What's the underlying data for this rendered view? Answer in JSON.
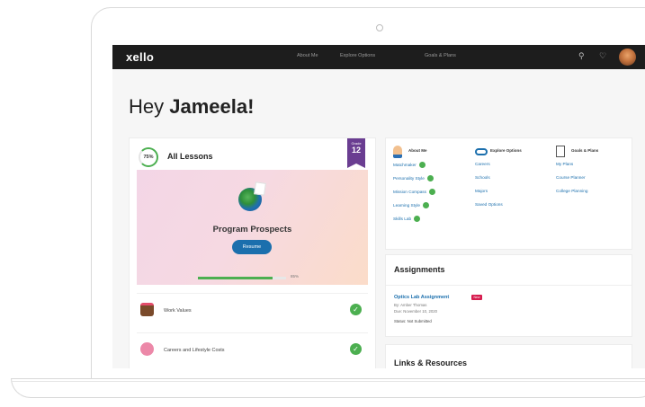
{
  "app": {
    "logo": "xello",
    "nav": [
      "About Me",
      "Explore Options",
      "Goals & Plans"
    ],
    "icons": [
      "search-icon",
      "heart-icon",
      "avatar"
    ]
  },
  "greeting": {
    "prefix": "Hey ",
    "name": "Jameela!"
  },
  "lessons": {
    "progress": "75%",
    "title": "All Lessons",
    "grade_label": "Grade",
    "grade": "12",
    "current": {
      "title": "Program Prospects",
      "button": "Resume",
      "progress_text": "85%",
      "progress_fraction": 0.85
    },
    "items": [
      {
        "label": "Work Values",
        "icon": "briefcase-icon",
        "completed": true
      },
      {
        "label": "Careers and Lifestyle Costs",
        "icon": "piggy-bank-icon",
        "completed": true
      }
    ]
  },
  "quick_links": {
    "columns": [
      {
        "title": "About Me",
        "icon": "person-icon",
        "links": [
          {
            "label": "Matchmaker",
            "done": true
          },
          {
            "label": "Personality Style",
            "done": true
          },
          {
            "label": "Mission Compass",
            "done": true
          },
          {
            "label": "Learning Style",
            "done": true
          },
          {
            "label": "Skills Lab",
            "done": true
          }
        ]
      },
      {
        "title": "Explore Options",
        "icon": "binoculars-icon",
        "links": [
          {
            "label": "Careers",
            "done": false
          },
          {
            "label": "Schools",
            "done": false
          },
          {
            "label": "Majors",
            "done": false
          },
          {
            "label": "Saved Options",
            "done": false
          }
        ]
      },
      {
        "title": "Goals & Plans",
        "icon": "notebook-icon",
        "links": [
          {
            "label": "My Plans",
            "done": false
          },
          {
            "label": "Course Planner",
            "done": false
          },
          {
            "label": "College Planning",
            "done": false
          }
        ]
      }
    ]
  },
  "assignments": {
    "title": "Assignments",
    "item": {
      "name": "Optics Lab Assignment",
      "badge": "New",
      "by": "By: Amber Thomas",
      "due": "Due: November 10, 2020",
      "status": "Status: Not Submitted"
    }
  },
  "resources": {
    "title": "Links & Resources"
  },
  "colors": {
    "accent": "#1b6fad",
    "success": "#4caf50",
    "grade_ribbon": "#6a3d91",
    "badge": "#d61c4e",
    "topbar": "#1d1d1d"
  }
}
